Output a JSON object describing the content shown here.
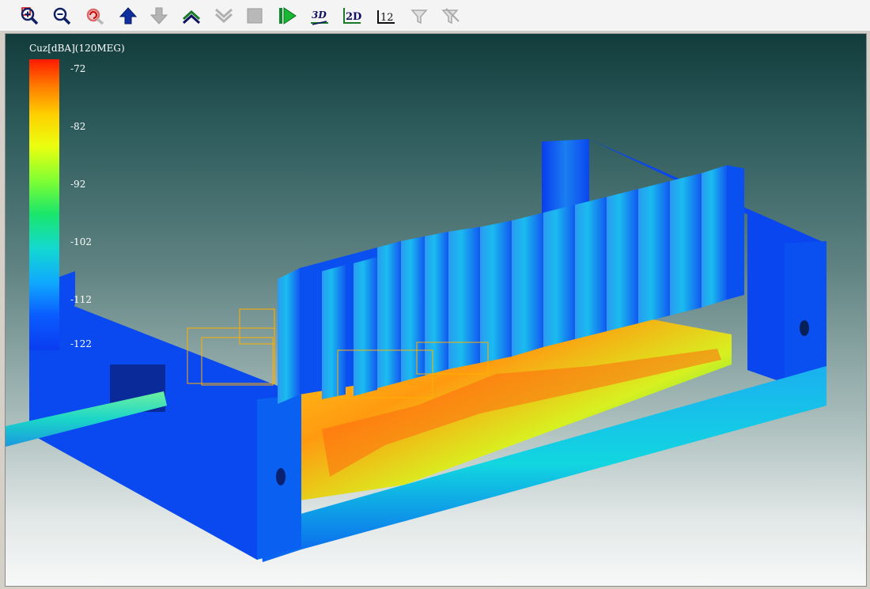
{
  "toolbar": {
    "buttons": [
      {
        "icon": "zoom-in-icon"
      },
      {
        "icon": "zoom-out-icon"
      },
      {
        "icon": "zoom-reset-icon"
      },
      {
        "icon": "arrow-up-icon"
      },
      {
        "icon": "arrow-down-icon"
      },
      {
        "icon": "chevron-up-icon"
      },
      {
        "icon": "chevron-down-icon"
      },
      {
        "icon": "stop-icon"
      },
      {
        "icon": "play-icon"
      },
      {
        "icon": "view-3d-icon",
        "label": "3D"
      },
      {
        "icon": "view-2d-icon",
        "label": "2D"
      },
      {
        "icon": "numbers-icon",
        "label": "12"
      },
      {
        "icon": "filter-icon"
      },
      {
        "icon": "filter-clear-icon"
      }
    ]
  },
  "scale": {
    "title": "Cuz[dBA](120MEG)",
    "ticks": [
      "-72",
      "-82",
      "-92",
      "-102",
      "-112",
      "-122"
    ]
  },
  "colors": {
    "bar_top": "#ff1a00",
    "bar_bottom": "#0a3cf0",
    "enclosure": "#0a4ff0",
    "fins": "#1e7ff0"
  }
}
